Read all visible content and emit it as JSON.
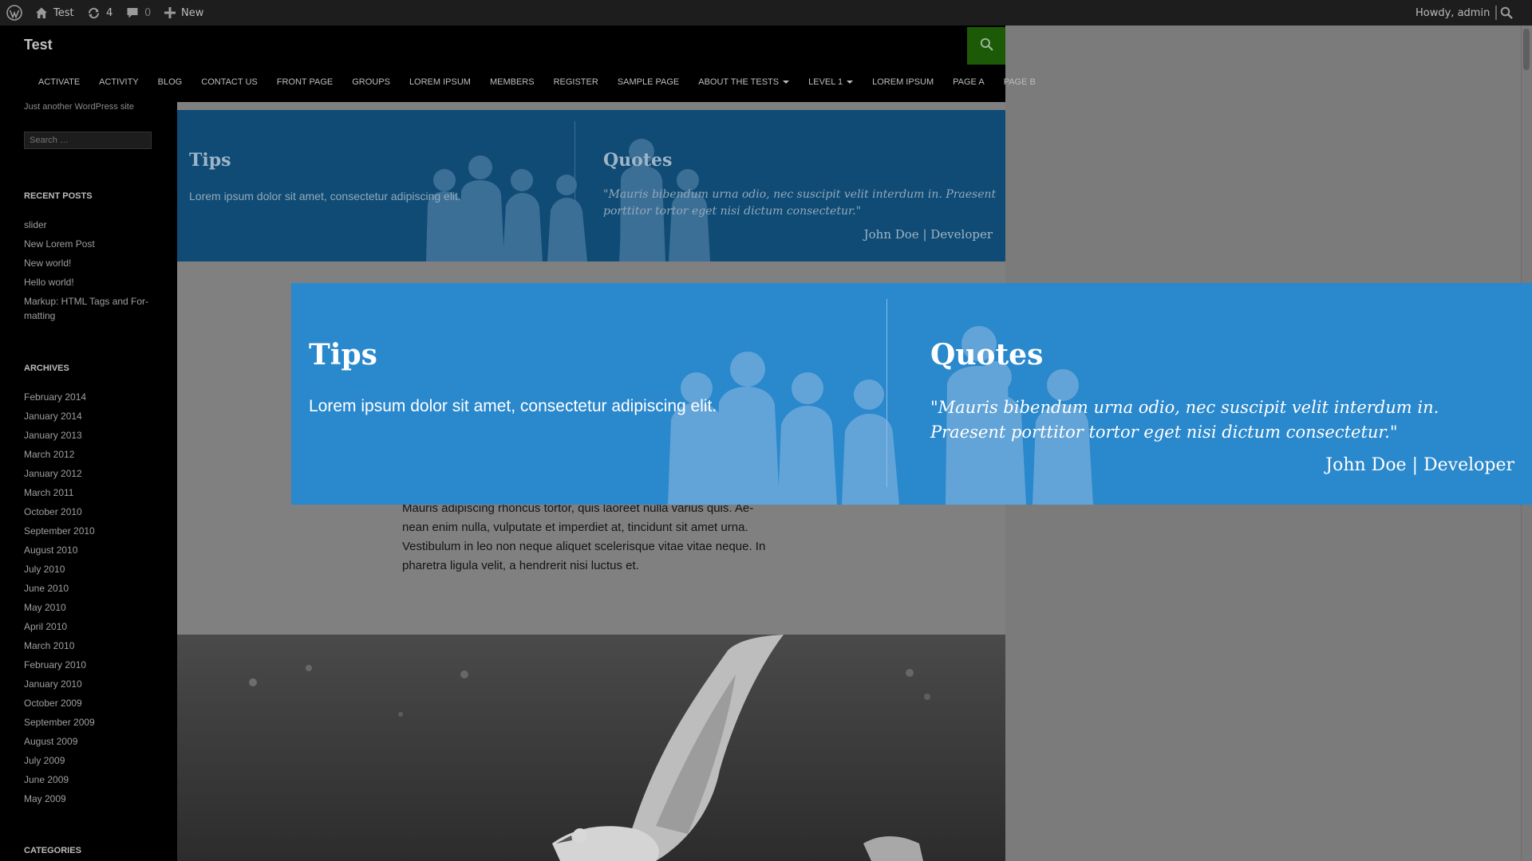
{
  "admin_bar": {
    "site_name": "Test",
    "updates_count": "4",
    "comments_count": "0",
    "new_label": "New",
    "howdy": "Howdy, admin"
  },
  "site": {
    "title": "Test",
    "tagline": "Just another WordPress site"
  },
  "nav": {
    "items": [
      "ACTIVATE",
      "ACTIVITY",
      "BLOG",
      "CONTACT US",
      "FRONT PAGE",
      "GROUPS",
      "LOREM IPSUM",
      "MEMBERS",
      "REGISTER",
      "SAMPLE PAGE",
      "ABOUT THE TESTS",
      "LEVEL 1",
      "LOREM IPSUM",
      "PAGE A",
      "PAGE B"
    ]
  },
  "sidebar": {
    "search_placeholder": "Search …",
    "recent_posts_title": "RECENT POSTS",
    "recent_posts": [
      "slider",
      "New Lorem Post",
      "New world!",
      "Hello world!",
      "Markup: HTML Tags and For-",
      "matting"
    ],
    "archives_title": "ARCHIVES",
    "archives": [
      "February 2014",
      "January 2014",
      "January 2013",
      "March 2012",
      "January 2012",
      "March 2011",
      "October 2010",
      "September 2010",
      "August 2010",
      "July 2010",
      "June 2010",
      "May 2010",
      "April 2010",
      "March 2010",
      "February 2010",
      "January 2010",
      "October 2009",
      "September 2009",
      "August 2009",
      "July 2009",
      "June 2009",
      "May 2009"
    ],
    "categories_title": "CATEGORIES"
  },
  "banner_dim": {
    "tips_title": "Tips",
    "tips_text": "Lorem ipsum dolor sit amet, consectetur adipiscing elit.",
    "quotes_title": "Quotes",
    "quote_text": "\"Mauris bibendum urna odio, nec suscipit velit interdum in. Praesent porttitor tortor eget nisi dictum consectetur.\"",
    "signature": "John Doe | Developer"
  },
  "banner_popup": {
    "tips_title": "Tips",
    "tips_text": "Lorem ipsum dolor sit amet, consectetur adipiscing elit.",
    "quotes_title": "Quotes",
    "quote_text": "\"Mauris bibendum urna odio, nec suscipit velit interdum in. Praesent porttitor tortor eget nisi dictum consectetur.\"",
    "signature": "John Doe | Developer"
  },
  "content": {
    "paragraph_lines": [
      "Mauris adipiscing rhoncus tortor, quis laoreet nulla varius quis. Ae-",
      "nean enim nulla, vulputate et imperdiet at, tincidunt sit amet urna.",
      "Vestibulum in leo non neque aliquet scelerisque vitae vitae neque. In",
      "pharetra ligula velit, a hendrerit nisi luctus et."
    ]
  },
  "colors": {
    "admin_bar_bg": "#1d1d1d",
    "search_toggle_bg": "#1c5a07",
    "banner_dim_bg": "#0f4b74",
    "banner_popup_bg": "#2a88cc"
  },
  "icons": [
    "wordpress-logo-icon",
    "home-icon",
    "updates-icon",
    "comment-icon",
    "plus-icon",
    "search-icon",
    "silhouette-people-icon"
  ]
}
